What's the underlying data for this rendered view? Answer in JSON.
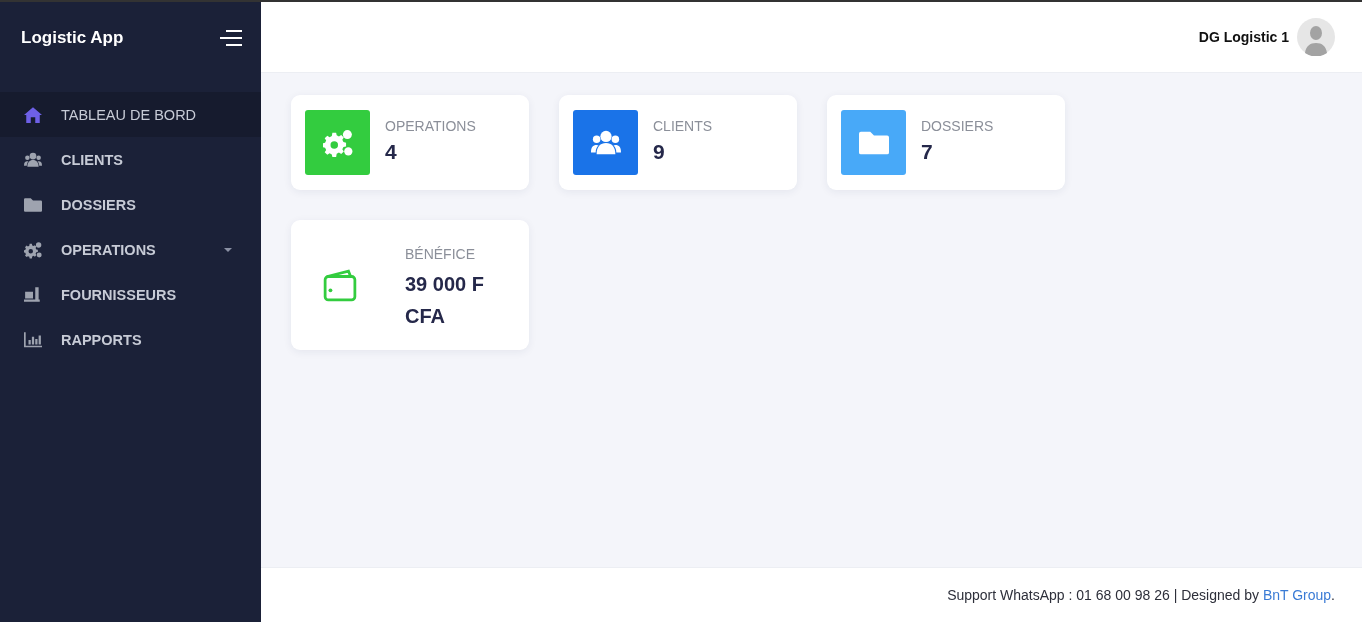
{
  "sidebar": {
    "brand": "Logistic App",
    "items": [
      {
        "label": "TABLEAU DE BORD",
        "kind": "link",
        "selected": true
      },
      {
        "label": "CLIENTS",
        "kind": "link",
        "selected": false
      },
      {
        "label": "DOSSIERS",
        "kind": "link",
        "selected": false
      },
      {
        "label": "OPERATIONS",
        "kind": "dropdown",
        "selected": false
      },
      {
        "label": "FOURNISSEURS",
        "kind": "link",
        "selected": false
      },
      {
        "label": "RAPPORTS",
        "kind": "link",
        "selected": false
      }
    ]
  },
  "topbar": {
    "user": "DG Logistic 1"
  },
  "cards": [
    {
      "label": "OPERATIONS",
      "value": "4",
      "kind": "filled",
      "color": "#33cc3f"
    },
    {
      "label": "CLIENTS",
      "value": "9",
      "kind": "filled",
      "color": "#1a73e8"
    },
    {
      "label": "DOSSIERS",
      "value": "7",
      "kind": "filled",
      "color": "#48a9f8"
    },
    {
      "label": "BÉNÉFICE",
      "value": "39 000 F CFA",
      "kind": "outline",
      "color": "#33cc3f"
    }
  ],
  "footer": {
    "text": "Support WhatsApp : 01 68 00 98 26 | Designed by",
    "link": "BnT Group",
    "tail": "."
  }
}
